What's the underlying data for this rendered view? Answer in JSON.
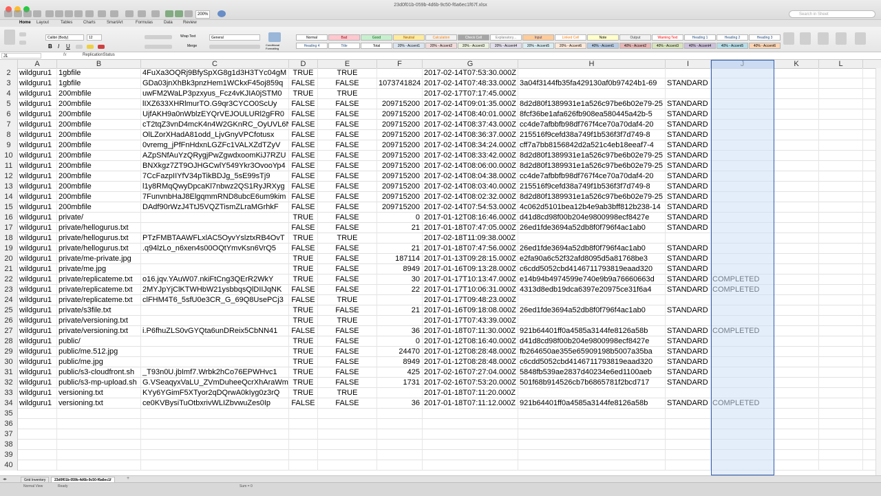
{
  "window": {
    "title": "23d0f01b-059b-4d6b-9c50-f6a6ec1f67f.xlsx",
    "search_placeholder": "Search in Sheet",
    "zoom": "200%"
  },
  "ribbon_tabs": [
    "Home",
    "Layout",
    "Tables",
    "Charts",
    "SmartArt",
    "Formulas",
    "Data",
    "Review"
  ],
  "ribbon": {
    "font_name": "Calibri (Body)",
    "font_size": "12",
    "wrap_text": "Wrap Text",
    "number_format": "General",
    "merge": "Merge",
    "conditional": "Conditional Formatting",
    "styles": [
      {
        "label": "Normal",
        "bg": "#ffffff",
        "fg": "#000000"
      },
      {
        "label": "Bad",
        "bg": "#ffc7ce",
        "fg": "#9c0006"
      },
      {
        "label": "Good",
        "bg": "#c6efce",
        "fg": "#006100"
      },
      {
        "label": "Neutral",
        "bg": "#ffeb9c",
        "fg": "#9c5700"
      },
      {
        "label": "Calculation",
        "bg": "#f2f2f2",
        "fg": "#fa7d00"
      },
      {
        "label": "Check Cell",
        "bg": "#a5a5a5",
        "fg": "#ffffff"
      },
      {
        "label": "Explanatory...",
        "bg": "#ffffff",
        "fg": "#7f7f7f"
      },
      {
        "label": "Input",
        "bg": "#ffcc99",
        "fg": "#3f3f76"
      },
      {
        "label": "Linked Cell",
        "bg": "#ffffff",
        "fg": "#fa7d00"
      },
      {
        "label": "Note",
        "bg": "#ffffcc",
        "fg": "#000000"
      },
      {
        "label": "Output",
        "bg": "#f2f2f2",
        "fg": "#3f3f3f"
      },
      {
        "label": "Warning Text",
        "bg": "#ffffff",
        "fg": "#ff0000"
      },
      {
        "label": "Heading 1",
        "bg": "#ffffff",
        "fg": "#1f497d"
      },
      {
        "label": "Heading 2",
        "bg": "#ffffff",
        "fg": "#1f497d"
      },
      {
        "label": "Heading 3",
        "bg": "#ffffff",
        "fg": "#1f497d"
      }
    ],
    "styles_row2": [
      {
        "label": "Heading 4",
        "bg": "#ffffff",
        "fg": "#1f497d"
      },
      {
        "label": "Title",
        "bg": "#ffffff",
        "fg": "#1f497d"
      },
      {
        "label": "Total",
        "bg": "#ffffff",
        "fg": "#000000"
      },
      {
        "label": "20% - Accent1",
        "bg": "#dce6f1",
        "fg": "#000000"
      },
      {
        "label": "20% - Accent2",
        "bg": "#f2dcdb",
        "fg": "#000000"
      },
      {
        "label": "20% - Accent3",
        "bg": "#ebf1de",
        "fg": "#000000"
      },
      {
        "label": "20% - Accent4",
        "bg": "#e4dfec",
        "fg": "#000000"
      },
      {
        "label": "20% - Accent5",
        "bg": "#daeef3",
        "fg": "#000000"
      },
      {
        "label": "20% - Accent6",
        "bg": "#fde9d9",
        "fg": "#000000"
      },
      {
        "label": "40% - Accent1",
        "bg": "#b8cce4",
        "fg": "#000000"
      },
      {
        "label": "40% - Accent2",
        "bg": "#e6b8b7",
        "fg": "#000000"
      },
      {
        "label": "40% - Accent3",
        "bg": "#d8e4bc",
        "fg": "#000000"
      },
      {
        "label": "40% - Accent4",
        "bg": "#ccc0da",
        "fg": "#000000"
      },
      {
        "label": "40% - Accent5",
        "bg": "#b7dee8",
        "fg": "#000000"
      },
      {
        "label": "40% - Accent6",
        "bg": "#fcd5b4",
        "fg": "#000000"
      }
    ]
  },
  "formula_bar": {
    "cell": "J1",
    "content": "ReplicationStatus"
  },
  "columns": [
    "A",
    "B",
    "C",
    "D",
    "E",
    "F",
    "G",
    "H",
    "I",
    "J",
    "K",
    "L"
  ],
  "selected_column": "J",
  "rows": [
    {
      "n": "2",
      "a": "wildguru1",
      "b": "1gbfile",
      "c": "4FuXa3OQRj9BfySpXG8g1d3H3TYc04gM",
      "d": "TRUE",
      "e": "TRUE",
      "f": "",
      "g": "2017-02-14T07:53:30.000Z",
      "h": "",
      "i": "",
      "j": ""
    },
    {
      "n": "3",
      "a": "wildguru1",
      "b": "1gbfile",
      "c": "GDa03jnXhBk3pnzHem1WCkxF45oj859q",
      "d": "FALSE",
      "e": "FALSE",
      "f": "1073741824",
      "g": "2017-02-14T07:48:33.000Z",
      "h": "3a04f3144fb35fa429130af0b97424b1-69",
      "i": "STANDARD",
      "j": ""
    },
    {
      "n": "4",
      "a": "wildguru1",
      "b": "200mbfile",
      "c": "uwFM2WaLP3pzxyus_Fcz4vKJIA0jSTM0",
      "d": "TRUE",
      "e": "TRUE",
      "f": "",
      "g": "2017-02-17T07:17:45.000Z",
      "h": "",
      "i": "",
      "j": ""
    },
    {
      "n": "5",
      "a": "wildguru1",
      "b": "200mbfile",
      "c": "lIXZ633XHRlmurTO.G9qr3CYCO0ScUy",
      "d": "FALSE",
      "e": "FALSE",
      "f": "209715200",
      "g": "2017-02-14T09:01:35.000Z",
      "h": "8d2d80f1389931e1a526c97be6b02e79-25",
      "i": "STANDARD",
      "j": ""
    },
    {
      "n": "6",
      "a": "wildguru1",
      "b": "200mbfile",
      "c": "UjfAKH9a0nWblzEYQrVEJOULURl2gFR0",
      "d": "FALSE",
      "e": "FALSE",
      "f": "209715200",
      "g": "2017-02-14T08:40:01.000Z",
      "h": "8fcf36be1afa626fb908ea580445a42b-5",
      "i": "STANDARD",
      "j": ""
    },
    {
      "n": "7",
      "a": "wildguru1",
      "b": "200mbfile",
      "c": "cT2tqZ3vnD4mcK4n4W2GKnRC_OyUVL6N",
      "d": "FALSE",
      "e": "FALSE",
      "f": "209715200",
      "g": "2017-02-14T08:37:43.000Z",
      "h": "cc4de7afbbfb98df767f4ce70a70daf4-20",
      "i": "STANDARD",
      "j": ""
    },
    {
      "n": "8",
      "a": "wildguru1",
      "b": "200mbfile",
      "c": "OlLZorXHadA81odd_LjvGnyVPCfotusx",
      "d": "FALSE",
      "e": "FALSE",
      "f": "209715200",
      "g": "2017-02-14T08:36:37.000Z",
      "h": "215516f9cefd38a749f1b536f3f7d749-8",
      "i": "STANDARD",
      "j": ""
    },
    {
      "n": "9",
      "a": "wildguru1",
      "b": "200mbfile",
      "c": "0vremg_jPfFnHdxnLGZFc1VALXZdTZyV",
      "d": "FALSE",
      "e": "FALSE",
      "f": "209715200",
      "g": "2017-02-14T08:34:24.000Z",
      "h": "cff7a7bb8156842d2a521c4eb18eeaf7-4",
      "i": "STANDARD",
      "j": ""
    },
    {
      "n": "10",
      "a": "wildguru1",
      "b": "200mbfile",
      "c": "AZpSNfAuYzQRygjPwZgwdxoomKiJ7RZU",
      "d": "FALSE",
      "e": "FALSE",
      "f": "209715200",
      "g": "2017-02-14T08:33:42.000Z",
      "h": "8d2d80f1389931e1a526c97be6b02e79-25",
      "i": "STANDARD",
      "j": ""
    },
    {
      "n": "11",
      "a": "wildguru1",
      "b": "200mbfile",
      "c": "BNXkgz7ZT9OJHGCwlY549Ykr3OvooYp4",
      "d": "FALSE",
      "e": "FALSE",
      "f": "209715200",
      "g": "2017-02-14T08:06:00.000Z",
      "h": "8d2d80f1389931e1a526c97be6b02e79-25",
      "i": "STANDARD",
      "j": ""
    },
    {
      "n": "12",
      "a": "wildguru1",
      "b": "200mbfile",
      "c": "7CcFazpIIYfV34pTikBDJg_5sE99sTj9",
      "d": "FALSE",
      "e": "FALSE",
      "f": "209715200",
      "g": "2017-02-14T08:04:38.000Z",
      "h": "cc4de7afbbfb98df767f4ce70a70daf4-20",
      "i": "STANDARD",
      "j": ""
    },
    {
      "n": "13",
      "a": "wildguru1",
      "b": "200mbfile",
      "c": "l1y8RMqQwyDpcaKl7nbwz2QS1RyJRXyg",
      "d": "FALSE",
      "e": "FALSE",
      "f": "209715200",
      "g": "2017-02-14T08:03:40.000Z",
      "h": "215516f9cefd38a749f1b536f3f7d749-8",
      "i": "STANDARD",
      "j": ""
    },
    {
      "n": "14",
      "a": "wildguru1",
      "b": "200mbfile",
      "c": "7FunvnbHaJ8ElgqmmRND8ubcE6um9kim",
      "d": "FALSE",
      "e": "FALSE",
      "f": "209715200",
      "g": "2017-02-14T08:02:32.000Z",
      "h": "8d2d80f1389931e1a526c97be6b02e79-25",
      "i": "STANDARD",
      "j": ""
    },
    {
      "n": "15",
      "a": "wildguru1",
      "b": "200mbfile",
      "c": "DAdf90rWzJ4TtJ5VQZTismZLraMGrhkF",
      "d": "FALSE",
      "e": "FALSE",
      "f": "209715200",
      "g": "2017-02-14T07:54:53.000Z",
      "h": "4c062d5101bea12b4e9ab3bff812b238-14",
      "i": "STANDARD",
      "j": ""
    },
    {
      "n": "16",
      "a": "wildguru1",
      "b": "private/",
      "c": "",
      "d": "TRUE",
      "e": "FALSE",
      "f": "0",
      "g": "2017-01-12T08:16:46.000Z",
      "h": "d41d8cd98f00b204e9800998ecf8427e",
      "i": "STANDARD",
      "j": ""
    },
    {
      "n": "17",
      "a": "wildguru1",
      "b": "private/hellogurus.txt",
      "c": "",
      "d": "FALSE",
      "e": "FALSE",
      "f": "21",
      "g": "2017-01-18T07:47:05.000Z",
      "h": "26ed1fde3694a52db8f0f796f4ac1ab0",
      "i": "STANDARD",
      "j": ""
    },
    {
      "n": "18",
      "a": "wildguru1",
      "b": "private/hellogurus.txt",
      "c": "PTzFMBTAAWFLxlAC5OyvYslztxRB4OvT",
      "d": "TRUE",
      "e": "TRUE",
      "f": "",
      "g": "2017-02-18T11:09:38.000Z",
      "h": "",
      "i": "",
      "j": ""
    },
    {
      "n": "19",
      "a": "wildguru1",
      "b": "private/hellogurus.txt",
      "c": ".q94lzLo_n6xen4s00OQtYmvKsn6VrQ5",
      "d": "FALSE",
      "e": "FALSE",
      "f": "21",
      "g": "2017-01-18T07:47:56.000Z",
      "h": "26ed1fde3694a52db8f0f796f4ac1ab0",
      "i": "STANDARD",
      "j": ""
    },
    {
      "n": "20",
      "a": "wildguru1",
      "b": "private/me-private.jpg",
      "c": "",
      "d": "TRUE",
      "e": "FALSE",
      "f": "187114",
      "g": "2017-01-13T09:28:15.000Z",
      "h": "e2fa90a6c52f32afd8095d5a81768be3",
      "i": "STANDARD",
      "j": ""
    },
    {
      "n": "21",
      "a": "wildguru1",
      "b": "private/me.jpg",
      "c": "",
      "d": "TRUE",
      "e": "FALSE",
      "f": "8949",
      "g": "2017-01-16T09:13:28.000Z",
      "h": "c6cdd5052cbd4146711793819eaad320",
      "i": "STANDARD",
      "j": ""
    },
    {
      "n": "22",
      "a": "wildguru1",
      "b": "private/replicateme.txt",
      "c": "o16.jqv.YAuW07.nkiFtCng3QErR2WkY",
      "d": "TRUE",
      "e": "FALSE",
      "f": "30",
      "g": "2017-01-17T10:13:47.000Z",
      "h": "e14b94b4974599e740e9b9a76660663d",
      "i": "STANDARD",
      "j": "COMPLETED"
    },
    {
      "n": "23",
      "a": "wildguru1",
      "b": "private/replicateme.txt",
      "c": "2MYJpYjClKTWHbW21ysbbqsQlDIIJqNK",
      "d": "FALSE",
      "e": "FALSE",
      "f": "22",
      "g": "2017-01-17T10:06:31.000Z",
      "h": "4313d8edb19dca6397e20975ce31f6a4",
      "i": "STANDARD",
      "j": "COMPLETED"
    },
    {
      "n": "24",
      "a": "wildguru1",
      "b": "private/replicateme.txt",
      "c": "clFHM4T6_5sfU0e3CR_G_69Q8UsePCj3",
      "d": "FALSE",
      "e": "TRUE",
      "f": "",
      "g": "2017-01-17T09:48:23.000Z",
      "h": "",
      "i": "",
      "j": ""
    },
    {
      "n": "25",
      "a": "wildguru1",
      "b": "private/s3file.txt",
      "c": "",
      "d": "TRUE",
      "e": "FALSE",
      "f": "21",
      "g": "2017-01-16T09:18:08.000Z",
      "h": "26ed1fde3694a52db8f0f796f4ac1ab0",
      "i": "STANDARD",
      "j": ""
    },
    {
      "n": "26",
      "a": "wildguru1",
      "b": "private/versioning.txt",
      "c": "",
      "d": "TRUE",
      "e": "TRUE",
      "f": "",
      "g": "2017-01-17T07:43:39.000Z",
      "h": "",
      "i": "",
      "j": ""
    },
    {
      "n": "27",
      "a": "wildguru1",
      "b": "private/versioning.txt",
      "c": "i.P6fhuZLS0vGYQta6unDReix5CbNN41",
      "d": "FALSE",
      "e": "FALSE",
      "f": "36",
      "g": "2017-01-18T07:11:30.000Z",
      "h": "921b64401ff0a4585a3144fe8126a58b",
      "i": "STANDARD",
      "j": "COMPLETED"
    },
    {
      "n": "28",
      "a": "wildguru1",
      "b": "public/",
      "c": "",
      "d": "TRUE",
      "e": "FALSE",
      "f": "0",
      "g": "2017-01-12T08:16:40.000Z",
      "h": "d41d8cd98f00b204e9800998ecf8427e",
      "i": "STANDARD",
      "j": ""
    },
    {
      "n": "29",
      "a": "wildguru1",
      "b": "public/me.512.jpg",
      "c": "",
      "d": "TRUE",
      "e": "FALSE",
      "f": "24470",
      "g": "2017-01-12T08:28:48.000Z",
      "h": "fb264650ae355e65909198b5007a35ba",
      "i": "STANDARD",
      "j": ""
    },
    {
      "n": "30",
      "a": "wildguru1",
      "b": "public/me.jpg",
      "c": "",
      "d": "TRUE",
      "e": "FALSE",
      "f": "8949",
      "g": "2017-01-12T08:28:48.000Z",
      "h": "c6cdd5052cbd4146711793819eaad320",
      "i": "STANDARD",
      "j": ""
    },
    {
      "n": "31",
      "a": "wildguru1",
      "b": "public/s3-cloudfront.sh",
      "c": "_T93n0U.jbImf7.Wrbk2hCo76EPWHvc1",
      "d": "TRUE",
      "e": "FALSE",
      "f": "425",
      "g": "2017-02-16T07:27:04.000Z",
      "h": "5848fb539ae2837d40234e6ed1100aeb",
      "i": "STANDARD",
      "j": ""
    },
    {
      "n": "32",
      "a": "wildguru1",
      "b": "public/s3-mp-upload.sh",
      "c": "G.VSeaqyxVaLU_ZVmDuheeQcrXhAraWm",
      "d": "TRUE",
      "e": "FALSE",
      "f": "1731",
      "g": "2017-02-16T07:53:20.000Z",
      "h": "501f68b914526cb7b6865781f2bcd717",
      "i": "STANDARD",
      "j": ""
    },
    {
      "n": "33",
      "a": "wildguru1",
      "b": "versioning.txt",
      "c": "KYy6YGimF5XTyor2qDQrwA0kIyg0z3rQ",
      "d": "TRUE",
      "e": "TRUE",
      "f": "",
      "g": "2017-01-18T07:11:20.000Z",
      "h": "",
      "i": "",
      "j": ""
    },
    {
      "n": "34",
      "a": "wildguru1",
      "b": "versioning.txt",
      "c": "ce0KVBysiTuOtbxrivWLIZbvwuZes0Ip",
      "d": "FALSE",
      "e": "FALSE",
      "f": "36",
      "g": "2017-01-18T07:11:12.000Z",
      "h": "921b64401ff0a4585a3144fe8126a58b",
      "i": "STANDARD",
      "j": "COMPLETED"
    },
    {
      "n": "35",
      "a": "",
      "b": "",
      "c": "",
      "d": "",
      "e": "",
      "f": "",
      "g": "",
      "h": "",
      "i": "",
      "j": ""
    },
    {
      "n": "36",
      "a": "",
      "b": "",
      "c": "",
      "d": "",
      "e": "",
      "f": "",
      "g": "",
      "h": "",
      "i": "",
      "j": ""
    },
    {
      "n": "37",
      "a": "",
      "b": "",
      "c": "",
      "d": "",
      "e": "",
      "f": "",
      "g": "",
      "h": "",
      "i": "",
      "j": ""
    },
    {
      "n": "38",
      "a": "",
      "b": "",
      "c": "",
      "d": "",
      "e": "",
      "f": "",
      "g": "",
      "h": "",
      "i": "",
      "j": ""
    },
    {
      "n": "39",
      "a": "",
      "b": "",
      "c": "",
      "d": "",
      "e": "",
      "f": "",
      "g": "",
      "h": "",
      "i": "",
      "j": ""
    },
    {
      "n": "40",
      "a": "",
      "b": "",
      "c": "",
      "d": "",
      "e": "",
      "f": "",
      "g": "",
      "h": "",
      "i": "",
      "j": ""
    }
  ],
  "sheets": [
    {
      "label": "Grid Inventory",
      "active": false
    },
    {
      "label": "23d0f01b-059b-4d6b-9c50-f6a6ec1f",
      "active": true
    }
  ],
  "status": {
    "view": "Normal View",
    "mode": "Ready",
    "sum": "Sum = 0"
  },
  "colors": {
    "selection": "#2f5fb3",
    "header_bg": "#efefef"
  }
}
